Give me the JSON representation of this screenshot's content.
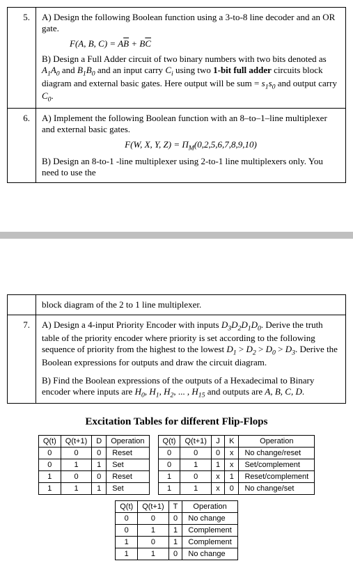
{
  "q5": {
    "num": "5.",
    "a": "A)  Design the following Boolean function using a 3-to-8 line decoder and an OR gate.",
    "a_formula": {
      "lhs": "F(A, B, C)",
      "eq": "=",
      "t1": "A",
      "t1b": "B",
      "plus": "+",
      "t2": "B",
      "t2b": "C"
    },
    "b_l1_pre": "B) Design a Full Adder circuit of two binary numbers with two bits denoted as ",
    "b_A1": "A",
    "b_A1s": "1",
    "b_A0": "A",
    "b_A0s": "0",
    "b_and": " and ",
    "b_B1": "B",
    "b_B1s": "1",
    "b_B0": "B",
    "b_B0s": "0",
    "b_l2a": " and an input carry ",
    "b_Ci": "C",
    "b_Cis": "i",
    "b_l2b": " using two ",
    "b_bold": "1-bit full adder",
    "b_l2c": " circuits block diagram and external basic gates. Here output will be sum = ",
    "b_s1": "s",
    "b_s1s": "1",
    "b_s0": "s",
    "b_s0s": "0",
    "b_l3": " and output carry ",
    "b_C0": "C",
    "b_C0s": "0",
    "b_dot": "."
  },
  "q6": {
    "num": "6.",
    "a": "A) Implement the following Boolean function with an 8–to–1–line multiplexer and external basic gates.",
    "a_formula": "F(W, X, Y, Z) = Π",
    "a_sub": "M",
    "a_args": "(0,2,5,6,7,8,9,10)",
    "b": "B) Design an 8-to-1 -line multiplexer using 2-to-1 line multiplexers only. You need to use the",
    "cont": "block diagram of the 2 to 1 line multiplexer."
  },
  "q7": {
    "num": "7.",
    "a_pre": "A) Design a 4-input Priority Encoder with inputs ",
    "D3": "D",
    "D3s": "3",
    "D2": "D",
    "D2s": "2",
    "D1": "D",
    "D1s": "1",
    "D0": "D",
    "D0s": "0",
    "a_mid": ". Derive the truth table of the priority encoder where priority is set according to the following sequence of priority from the highest to the lowest ",
    "seq": {
      "D1": "D",
      "D1s": "1",
      "gt1": " > ",
      "D2": "D",
      "D2s": "2",
      "gt2": " > ",
      "D0": "D",
      "D0s": "0",
      "gt3": " > ",
      "D3": "D",
      "D3s": "3"
    },
    "a_post": ". Derive the Boolean expressions for outputs and draw the circuit diagram.",
    "b_pre": "B) Find the Boolean expressions of the outputs of a Hexadecimal to Binary encoder where inputs are ",
    "H0": "H",
    "H0s": "0",
    "c": ", ",
    "H1": "H",
    "H1s": "1",
    "H2": "H",
    "H2s": "2",
    "dots": ", ... , ",
    "H15": "H",
    "H15s": "15",
    "b_mid": " and outputs are ",
    "outs": "A, B, C, D",
    "b_end": "."
  },
  "heading": "Excitation Tables for different Flip-Flops",
  "ffD": {
    "h": [
      "Q(t)",
      "Q(t+1)",
      "D",
      "Operation"
    ],
    "r": [
      [
        "0",
        "0",
        "0",
        "Reset"
      ],
      [
        "0",
        "1",
        "1",
        "Set"
      ],
      [
        "1",
        "0",
        "0",
        "Reset"
      ],
      [
        "1",
        "1",
        "1",
        "Set"
      ]
    ]
  },
  "ffJK": {
    "h": [
      "Q(t)",
      "Q(t+1)",
      "J",
      "K",
      "Operation"
    ],
    "r": [
      [
        "0",
        "0",
        "0",
        "x",
        "No change/reset"
      ],
      [
        "0",
        "1",
        "1",
        "x",
        "Set/complement"
      ],
      [
        "1",
        "0",
        "x",
        "1",
        "Reset/complement"
      ],
      [
        "1",
        "1",
        "x",
        "0",
        "No change/set"
      ]
    ]
  },
  "ffT": {
    "h": [
      "Q(t)",
      "Q(t+1)",
      "T",
      "Operation"
    ],
    "r": [
      [
        "0",
        "0",
        "0",
        "No change"
      ],
      [
        "0",
        "1",
        "1",
        "Complement"
      ],
      [
        "1",
        "0",
        "1",
        "Complement"
      ],
      [
        "1",
        "1",
        "0",
        "No change"
      ]
    ]
  }
}
